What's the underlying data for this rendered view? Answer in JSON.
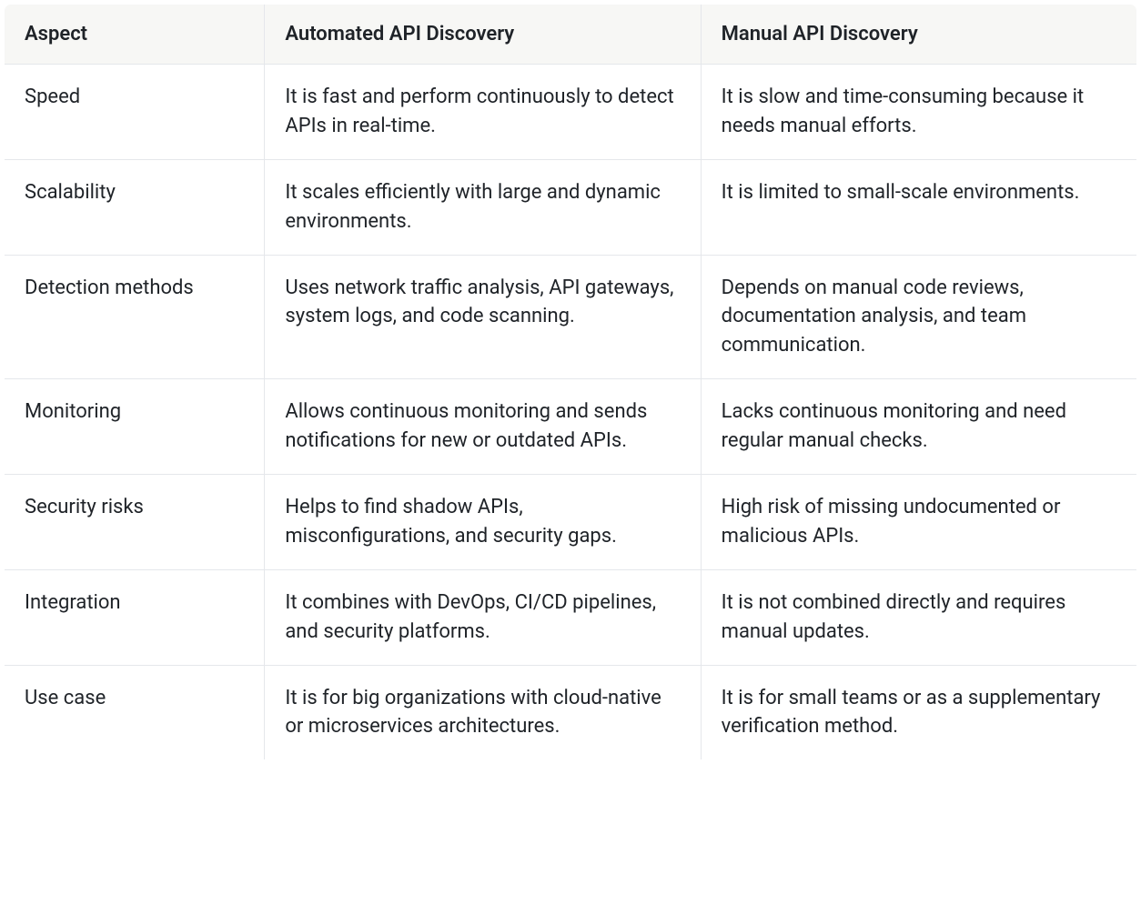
{
  "table": {
    "headers": {
      "aspect": "Aspect",
      "automated": "Automated API Discovery",
      "manual": "Manual API Discovery"
    },
    "rows": [
      {
        "aspect": "Speed",
        "automated": "It is fast and perform continuously to detect APIs in real-time.",
        "manual": "It is slow and time-consuming because it needs manual efforts."
      },
      {
        "aspect": "Scalability",
        "automated": "It scales efficiently with large and dynamic environments.",
        "manual": "It is limited to small-scale environments."
      },
      {
        "aspect": "Detection methods",
        "automated": "Uses network traffic analysis, API gateways, system logs, and code scanning.",
        "manual": "Depends on manual code reviews, documentation analysis, and team communication."
      },
      {
        "aspect": "Monitoring",
        "automated": "Allows continuous monitoring and sends notifications for new or outdated APIs.",
        "manual": "Lacks continuous monitoring and need regular manual checks."
      },
      {
        "aspect": "Security risks",
        "automated": "Helps to find shadow APIs, misconfigurations, and security gaps.",
        "manual": "High risk of missing undocumented or malicious APIs."
      },
      {
        "aspect": "Integration",
        "automated": "It combines with DevOps, CI/CD pipelines, and security platforms.",
        "manual": "It is not combined directly and requires manual updates."
      },
      {
        "aspect": "Use case",
        "automated": "It is for big organizations with cloud-native or microservices architectures.",
        "manual": "It is for small teams or as a supplementary verification method."
      }
    ]
  }
}
